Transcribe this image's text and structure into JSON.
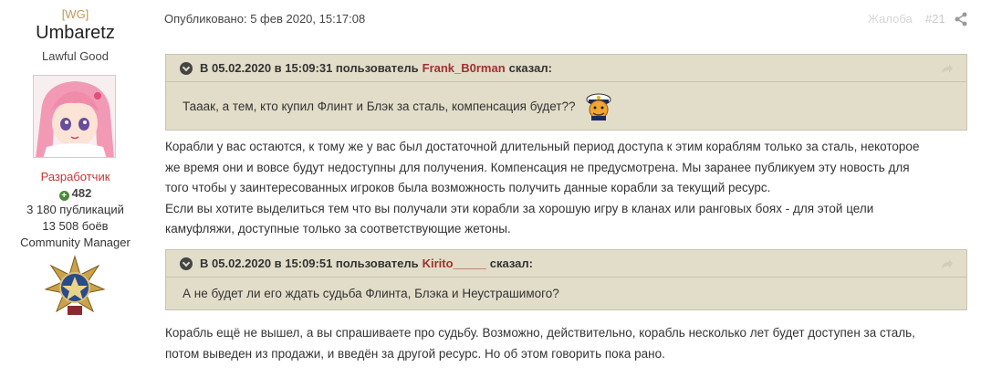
{
  "author": {
    "clan": "[WG]",
    "username": "Umbaretz",
    "user_title": "Lawful Good",
    "role": "Разработчик",
    "reputation": "482",
    "posts": "3 180 публикаций",
    "battles": "13 508 боёв",
    "group": "Community Manager"
  },
  "post": {
    "posted": "Опубликовано: 5 фев 2020, 15:17:08",
    "report_label": "Жалоба",
    "post_number": "#21"
  },
  "quotes": [
    {
      "prefix": "В 05.02.2020 в 15:09:31 пользователь",
      "user": "Frank_B0rman",
      "suffix": "сказал:",
      "text": "Тааак, а тем, кто купил Флинт и Блэк за сталь, компенсация будет??"
    },
    {
      "prefix": "В 05.02.2020 в 15:09:51 пользователь",
      "user": "Kirito_____",
      "suffix": "сказал:",
      "text": "А не будет ли его ждать судьба Флинта, Блэка и Неустрашимого?"
    }
  ],
  "replies": [
    {
      "lines": [
        "Корабли у вас остаются, к тому же у вас был достаточной длительный период доступа к этим кораблям только за сталь, некоторое",
        "же время они и вовсе будут недоступны для получения. Компенсация не предусмотрена. Мы заранее публикуем эту новость для",
        "того чтобы у заинтересованных игроков была возможность получить данные корабли за текущий ресурс.",
        "Если вы хотите выделиться тем что вы получали эти корабли за хорошую игру в кланах или ранговых боях - для этой цели",
        "камуфляжи, доступные только за соответствующие жетоны."
      ]
    },
    {
      "lines": [
        "Корабль ещё не вышел, а вы спрашиваете про судьбу. Возможно, действительно, корабль несколько лет будет доступен за сталь,",
        "потом выведен из продажи, и введён за другой ресурс. Но об этом говорить пока рано."
      ]
    }
  ]
}
